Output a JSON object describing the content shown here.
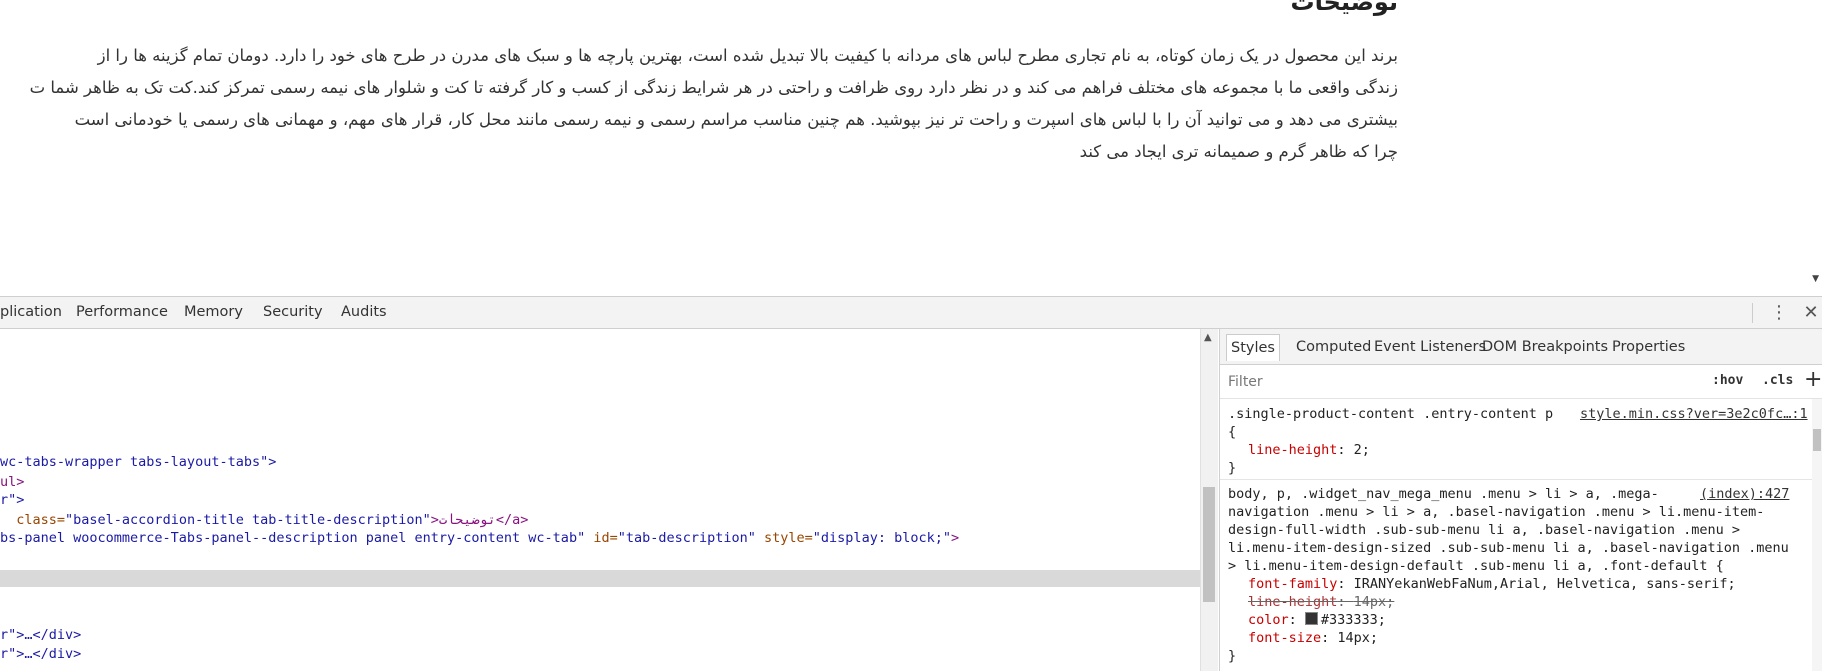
{
  "page": {
    "heading": "توضیحات",
    "paragraph_lines": [
      "برند این محصول در یک زمان کوتاه،  به نام تجاری مطرح لباس های مردانه با کیفیت بالا تبدیل شده است، بهترین پارچه ها و سبک های مدرن در طرح های خود را دارد. دومان تمام گزینه ها را از",
      "زندگی واقعی ما با مجموعه های مختلف فراهم می کند و در نظر دارد روی ظرافت و راحتی در هر شرایط زندگی از کسب و کار گرفته تا کت و شلوار های نیمه رسمی تمرکز کند.کت تک به ظاهر شما ت",
      "بیشتری می دهد و می توانید آن را با لباس های اسپرت و راحت تر نیز بپوشید. هم چنین مناسب مراسم رسمی و نیمه رسمی مانند محل کار، قرار های مهم، و مهمانی های رسمی یا خودمانی است",
      "چرا که ظاهر گرم و صمیمانه تری ایجاد می کند"
    ]
  },
  "devtools": {
    "tabs": [
      "plication",
      "Performance",
      "Memory",
      "Security",
      "Audits"
    ],
    "icons": {
      "more": "vertical-ellipsis-icon",
      "close": "close-icon"
    },
    "elements": {
      "lines": [
        {
          "attr": "",
          "pre": "wc-tabs-wrapper tabs-layout-tabs\">",
          "val": "",
          "post": ""
        },
        {
          "pre": "ul>"
        },
        {
          "pre": "r\">"
        },
        {
          "pre": "  class=",
          "val": "\"basel-accordion-title tab-title-description\"",
          "post": ">توضیحات</a>"
        },
        {
          "pre": "bs-panel woocommerce-Tabs-panel--description panel entry-content wc-tab\" ",
          "attr": "id=",
          "val": "\"tab-description\"",
          "attr2": " style=",
          "val2": "\"display: block;\"",
          "post": ">"
        },
        {
          "pre": "r\">…</div>"
        },
        {
          "pre": "r\">…</div>"
        }
      ]
    },
    "styles": {
      "sub_tabs": [
        "Styles",
        "Computed",
        "Event Listeners",
        "DOM Breakpoints",
        "Properties"
      ],
      "active_sub_tab": "Styles",
      "filter_placeholder": "Filter",
      "hov_label": ":hov",
      "cls_label": ".cls",
      "add_label": "+",
      "rule1": {
        "selector": ".single-product-content .entry-content p",
        "source": "style.min.css?ver=3e2c0fc…:1",
        "open": "{",
        "prop": "line-height",
        "value": "2;",
        "close": "}"
      },
      "rule2": {
        "selector_lines": [
          "body, p, .widget_nav_mega_menu .menu > li > a, .mega-",
          "navigation .menu > li > a, .basel-navigation .menu > li.menu-item-",
          "design-full-width .sub-sub-menu li a, .basel-navigation .menu >",
          "li.menu-item-design-sized .sub-sub-menu li a, .basel-navigation .menu",
          "> li.menu-item-design-default .sub-menu li a, .font-default {"
        ],
        "source": "(index):427",
        "props": [
          {
            "name": "font-family",
            "value": "IRANYekanWebFaNum,Arial, Helvetica, sans-serif;",
            "struck": false
          },
          {
            "name": "line-height",
            "value": "14px;",
            "struck": true
          },
          {
            "name": "color",
            "value": "#333333;",
            "struck": false,
            "swatch": "#333333"
          },
          {
            "name": "font-size",
            "value": "14px;",
            "struck": false
          }
        ],
        "close": "}"
      }
    }
  }
}
